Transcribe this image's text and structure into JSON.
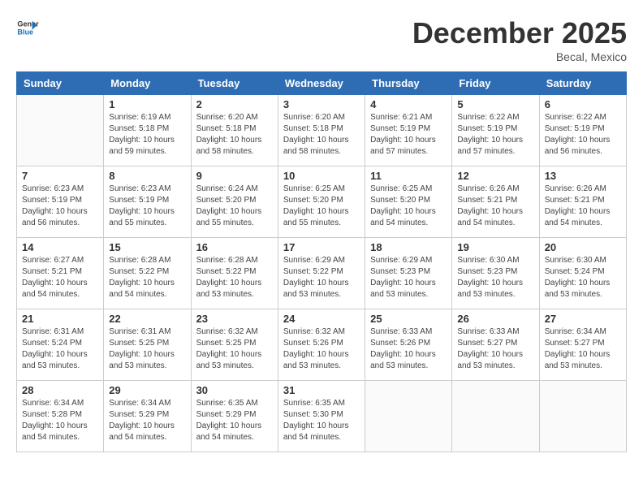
{
  "header": {
    "logo": {
      "general": "General",
      "blue": "Blue"
    },
    "title": "December 2025",
    "subtitle": "Becal, Mexico"
  },
  "calendar": {
    "days": [
      "Sunday",
      "Monday",
      "Tuesday",
      "Wednesday",
      "Thursday",
      "Friday",
      "Saturday"
    ],
    "weeks": [
      [
        {
          "date": "",
          "info": ""
        },
        {
          "date": "1",
          "info": "Sunrise: 6:19 AM\nSunset: 5:18 PM\nDaylight: 10 hours\nand 59 minutes."
        },
        {
          "date": "2",
          "info": "Sunrise: 6:20 AM\nSunset: 5:18 PM\nDaylight: 10 hours\nand 58 minutes."
        },
        {
          "date": "3",
          "info": "Sunrise: 6:20 AM\nSunset: 5:18 PM\nDaylight: 10 hours\nand 58 minutes."
        },
        {
          "date": "4",
          "info": "Sunrise: 6:21 AM\nSunset: 5:19 PM\nDaylight: 10 hours\nand 57 minutes."
        },
        {
          "date": "5",
          "info": "Sunrise: 6:22 AM\nSunset: 5:19 PM\nDaylight: 10 hours\nand 57 minutes."
        },
        {
          "date": "6",
          "info": "Sunrise: 6:22 AM\nSunset: 5:19 PM\nDaylight: 10 hours\nand 56 minutes."
        }
      ],
      [
        {
          "date": "7",
          "info": "Sunrise: 6:23 AM\nSunset: 5:19 PM\nDaylight: 10 hours\nand 56 minutes."
        },
        {
          "date": "8",
          "info": "Sunrise: 6:23 AM\nSunset: 5:19 PM\nDaylight: 10 hours\nand 55 minutes."
        },
        {
          "date": "9",
          "info": "Sunrise: 6:24 AM\nSunset: 5:20 PM\nDaylight: 10 hours\nand 55 minutes."
        },
        {
          "date": "10",
          "info": "Sunrise: 6:25 AM\nSunset: 5:20 PM\nDaylight: 10 hours\nand 55 minutes."
        },
        {
          "date": "11",
          "info": "Sunrise: 6:25 AM\nSunset: 5:20 PM\nDaylight: 10 hours\nand 54 minutes."
        },
        {
          "date": "12",
          "info": "Sunrise: 6:26 AM\nSunset: 5:21 PM\nDaylight: 10 hours\nand 54 minutes."
        },
        {
          "date": "13",
          "info": "Sunrise: 6:26 AM\nSunset: 5:21 PM\nDaylight: 10 hours\nand 54 minutes."
        }
      ],
      [
        {
          "date": "14",
          "info": "Sunrise: 6:27 AM\nSunset: 5:21 PM\nDaylight: 10 hours\nand 54 minutes."
        },
        {
          "date": "15",
          "info": "Sunrise: 6:28 AM\nSunset: 5:22 PM\nDaylight: 10 hours\nand 54 minutes."
        },
        {
          "date": "16",
          "info": "Sunrise: 6:28 AM\nSunset: 5:22 PM\nDaylight: 10 hours\nand 53 minutes."
        },
        {
          "date": "17",
          "info": "Sunrise: 6:29 AM\nSunset: 5:22 PM\nDaylight: 10 hours\nand 53 minutes."
        },
        {
          "date": "18",
          "info": "Sunrise: 6:29 AM\nSunset: 5:23 PM\nDaylight: 10 hours\nand 53 minutes."
        },
        {
          "date": "19",
          "info": "Sunrise: 6:30 AM\nSunset: 5:23 PM\nDaylight: 10 hours\nand 53 minutes."
        },
        {
          "date": "20",
          "info": "Sunrise: 6:30 AM\nSunset: 5:24 PM\nDaylight: 10 hours\nand 53 minutes."
        }
      ],
      [
        {
          "date": "21",
          "info": "Sunrise: 6:31 AM\nSunset: 5:24 PM\nDaylight: 10 hours\nand 53 minutes."
        },
        {
          "date": "22",
          "info": "Sunrise: 6:31 AM\nSunset: 5:25 PM\nDaylight: 10 hours\nand 53 minutes."
        },
        {
          "date": "23",
          "info": "Sunrise: 6:32 AM\nSunset: 5:25 PM\nDaylight: 10 hours\nand 53 minutes."
        },
        {
          "date": "24",
          "info": "Sunrise: 6:32 AM\nSunset: 5:26 PM\nDaylight: 10 hours\nand 53 minutes."
        },
        {
          "date": "25",
          "info": "Sunrise: 6:33 AM\nSunset: 5:26 PM\nDaylight: 10 hours\nand 53 minutes."
        },
        {
          "date": "26",
          "info": "Sunrise: 6:33 AM\nSunset: 5:27 PM\nDaylight: 10 hours\nand 53 minutes."
        },
        {
          "date": "27",
          "info": "Sunrise: 6:34 AM\nSunset: 5:27 PM\nDaylight: 10 hours\nand 53 minutes."
        }
      ],
      [
        {
          "date": "28",
          "info": "Sunrise: 6:34 AM\nSunset: 5:28 PM\nDaylight: 10 hours\nand 54 minutes."
        },
        {
          "date": "29",
          "info": "Sunrise: 6:34 AM\nSunset: 5:29 PM\nDaylight: 10 hours\nand 54 minutes."
        },
        {
          "date": "30",
          "info": "Sunrise: 6:35 AM\nSunset: 5:29 PM\nDaylight: 10 hours\nand 54 minutes."
        },
        {
          "date": "31",
          "info": "Sunrise: 6:35 AM\nSunset: 5:30 PM\nDaylight: 10 hours\nand 54 minutes."
        },
        {
          "date": "",
          "info": ""
        },
        {
          "date": "",
          "info": ""
        },
        {
          "date": "",
          "info": ""
        }
      ]
    ]
  }
}
